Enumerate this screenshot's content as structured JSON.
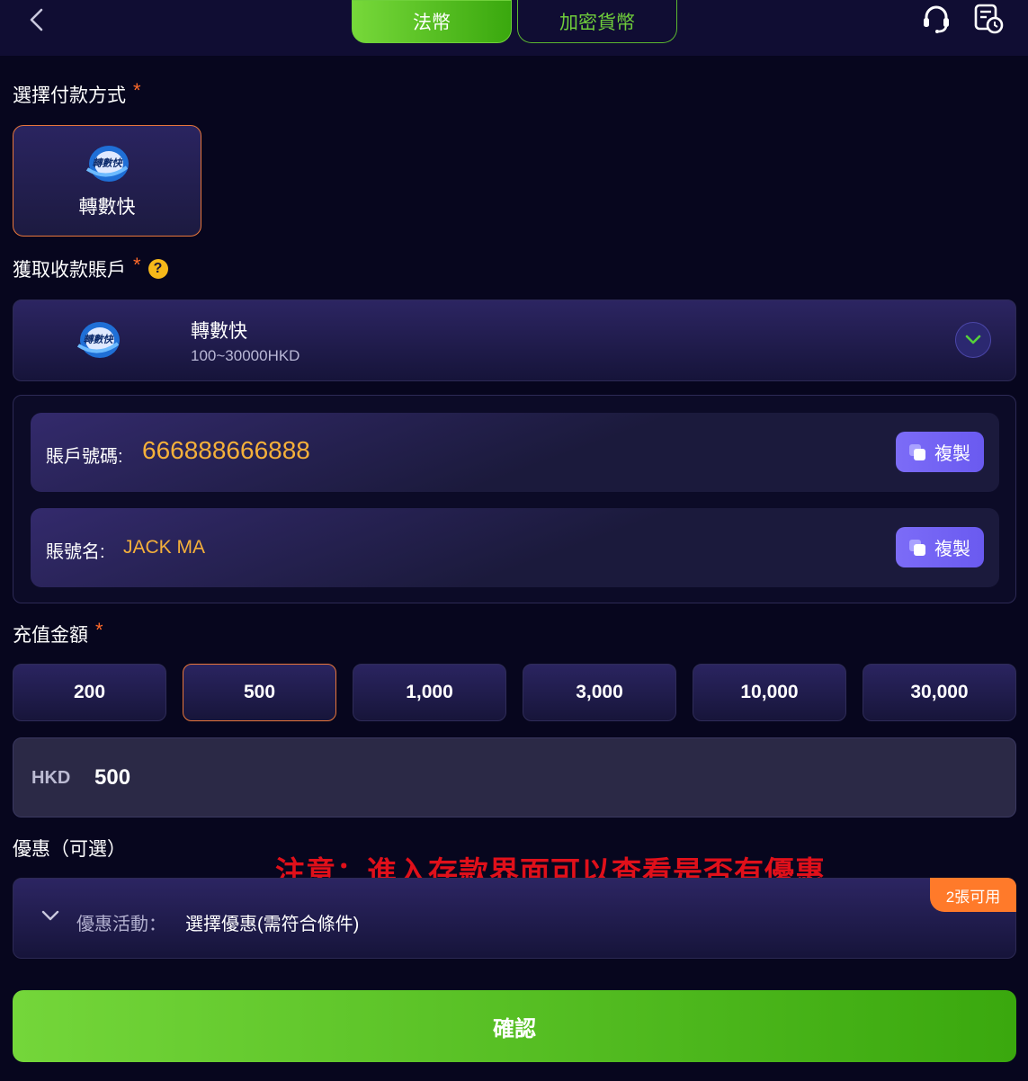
{
  "header": {
    "tabs": [
      {
        "label": "法幣",
        "active": true
      },
      {
        "label": "加密貨幣",
        "active": false
      }
    ],
    "icons": [
      "back-chevron-icon",
      "headset-support-icon",
      "history-clock-icon"
    ]
  },
  "payment_method": {
    "label": "選擇付款方式",
    "required_mark": "*",
    "options": [
      {
        "name": "轉數快",
        "logo_text": "轉數快"
      }
    ]
  },
  "receiving_account": {
    "label": "獲取收款賬戶",
    "required_mark": "*",
    "help_icon": "?",
    "selected": {
      "name": "轉數快",
      "range": "100~30000HKD",
      "logo_text": "轉數快"
    }
  },
  "account_details": {
    "number_label": "賬戶號碼:",
    "number_value": "666888666888",
    "name_label": "賬號名:",
    "name_value": "JACK MA",
    "copy_label": "複製"
  },
  "amount": {
    "label": "充值金額",
    "required_mark": "*",
    "presets": [
      "200",
      "500",
      "1,000",
      "3,000",
      "10,000",
      "30,000"
    ],
    "selected_preset": "500",
    "currency": "HKD",
    "value": "500"
  },
  "promotion": {
    "label": "優惠（可選）",
    "notice": "注意：進入存款界面可以查看是否有優惠",
    "field_label": "優惠活動：",
    "field_value": "選擇優惠(需符合條件)",
    "badge": "2張可用"
  },
  "confirm_label": "確認",
  "colors": {
    "background": "#07061e",
    "accent_green": "#4cbb1e",
    "accent_orange": "#e8763a",
    "value_yellow": "#f5b03a",
    "copy_purple": "#7264f4",
    "notice_red": "#e0101a"
  }
}
